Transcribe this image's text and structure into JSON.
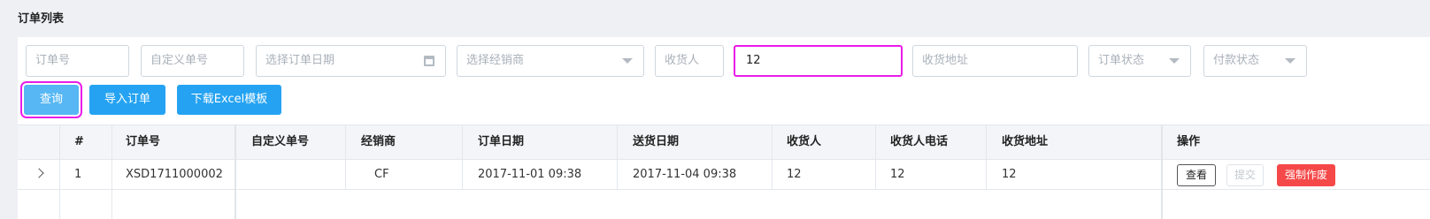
{
  "page": {
    "title": "订单列表"
  },
  "filters": {
    "order_no": {
      "placeholder": "订单号",
      "value": ""
    },
    "custom_no": {
      "placeholder": "自定义单号",
      "value": ""
    },
    "order_date": {
      "placeholder": "选择订单日期",
      "icon": "calendar-icon"
    },
    "dealer": {
      "placeholder": "选择经销商",
      "icon": "chevron-down-icon"
    },
    "receiver": {
      "placeholder": "收货人",
      "value": ""
    },
    "phone": {
      "placeholder": "",
      "value": "12"
    },
    "address": {
      "placeholder": "收货地址",
      "value": ""
    },
    "order_status": {
      "placeholder": "订单状态",
      "icon": "chevron-down-icon"
    },
    "payment_status": {
      "placeholder": "付款状态",
      "icon": "chevron-down-icon"
    }
  },
  "actions": {
    "query": "查询",
    "import": "导入订单",
    "download": "下载Excel模板"
  },
  "table": {
    "columns": [
      "#",
      "订单号",
      "自定义单号",
      "经销商",
      "订单日期",
      "送货日期",
      "收货人",
      "收货人电话",
      "收货地址",
      "操作"
    ],
    "rows": [
      {
        "index": "1",
        "order_no": "XSD1711000002",
        "custom_no": "",
        "dealer": "CF",
        "order_date": "2017-11-01 09:38",
        "delivery_date": "2017-11-04 09:38",
        "receiver": "12",
        "phone": "12",
        "address": "12",
        "ops": {
          "view": "查看",
          "submit": "提交",
          "void": "强制作废"
        }
      }
    ]
  },
  "colors": {
    "primary": "#25a3f2",
    "danger": "#f54848",
    "highlight": "#e81ce8"
  }
}
